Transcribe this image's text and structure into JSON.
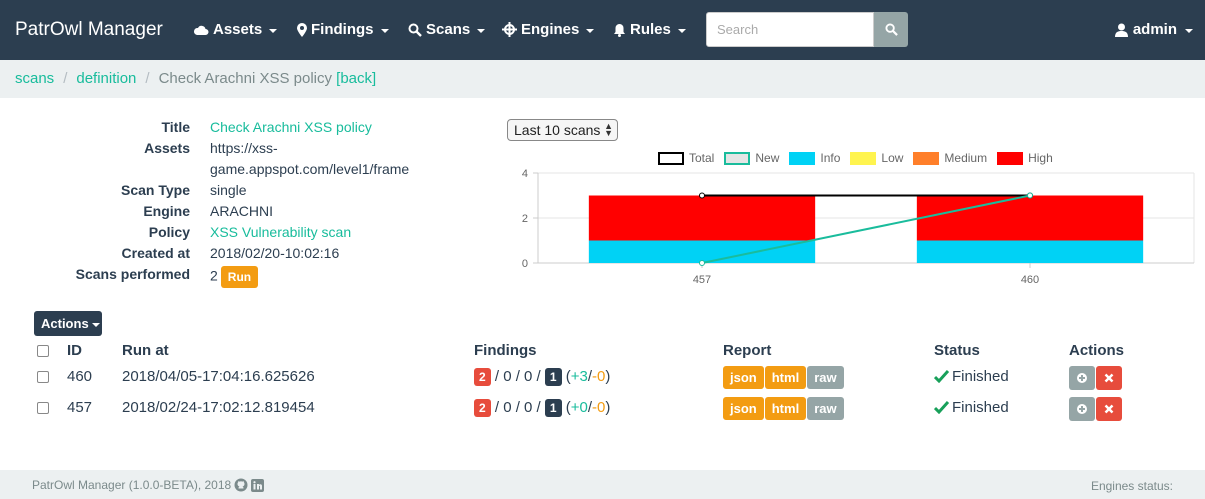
{
  "navbar": {
    "brand": "PatrOwl Manager",
    "items": [
      {
        "label": "Assets",
        "icon": "cloud-icon"
      },
      {
        "label": "Findings",
        "icon": "map-marker-icon"
      },
      {
        "label": "Scans",
        "icon": "search-icon"
      },
      {
        "label": "Engines",
        "icon": "crosshair-icon"
      },
      {
        "label": "Rules",
        "icon": "bell-icon"
      }
    ],
    "search_placeholder": "Search",
    "user": "admin"
  },
  "breadcrumb": {
    "items": [
      "scans",
      "definition"
    ],
    "current": "Check Arachni XSS policy",
    "back": "[back]"
  },
  "details": {
    "rows": [
      {
        "label": "Title",
        "value": "Check Arachni XSS policy"
      },
      {
        "label": "Assets",
        "value": "https://xss-",
        "value2": "game.appspot.com/level1/frame"
      },
      {
        "label": "Scan Type",
        "value": "single"
      },
      {
        "label": "Engine",
        "value": "ARACHNI"
      },
      {
        "label": "Policy",
        "value": "XSS Vulnerability scan"
      },
      {
        "label": "Created at",
        "value": "2018/02/20-10:02:16"
      },
      {
        "label": "Scans performed",
        "value": "2"
      }
    ],
    "run_label": "Run"
  },
  "select": {
    "value": "Last 10 scans"
  },
  "chart_data": {
    "type": "bar",
    "categories": [
      "457",
      "460"
    ],
    "series": [
      {
        "name": "Total",
        "type": "line",
        "color": "#000000",
        "values": [
          3,
          3
        ]
      },
      {
        "name": "New",
        "type": "line",
        "color": "#1abc9c",
        "values": [
          0,
          3
        ]
      },
      {
        "name": "Info",
        "type": "bar",
        "color": "#00d2f5",
        "values": [
          1,
          1
        ]
      },
      {
        "name": "Low",
        "type": "bar",
        "color": "#fff44f",
        "values": [
          0,
          0
        ]
      },
      {
        "name": "Medium",
        "type": "bar",
        "color": "#ff7f2a",
        "values": [
          0,
          0
        ]
      },
      {
        "name": "High",
        "type": "bar",
        "color": "#ff0000",
        "values": [
          2,
          2
        ]
      }
    ],
    "stacked": true,
    "ylim": [
      0,
      4
    ],
    "yticks": [
      "0",
      "2",
      "4"
    ],
    "legend_position": "top"
  },
  "actions_label": "Actions",
  "table": {
    "headers": {
      "id": "ID",
      "run_at": "Run at",
      "findings": "Findings",
      "report": "Report",
      "status": "Status",
      "actions": "Actions"
    },
    "rows": [
      {
        "id": "460",
        "run_at": "2018/04/05-17:04:16.625626",
        "high": "2",
        "mid": "/ 0 / 0 /",
        "info": "1",
        "plus": "+3",
        "minus": "-0",
        "status": "Finished"
      },
      {
        "id": "457",
        "run_at": "2018/02/24-17:02:12.819454",
        "high": "2",
        "mid": "/ 0 / 0 /",
        "info": "1",
        "plus": "+0",
        "minus": "-0",
        "status": "Finished"
      }
    ],
    "report_buttons": [
      "json",
      "html",
      "raw"
    ]
  },
  "footer": {
    "left": "PatrOwl Manager (1.0.0-BETA), 2018",
    "right": "Engines status:"
  }
}
